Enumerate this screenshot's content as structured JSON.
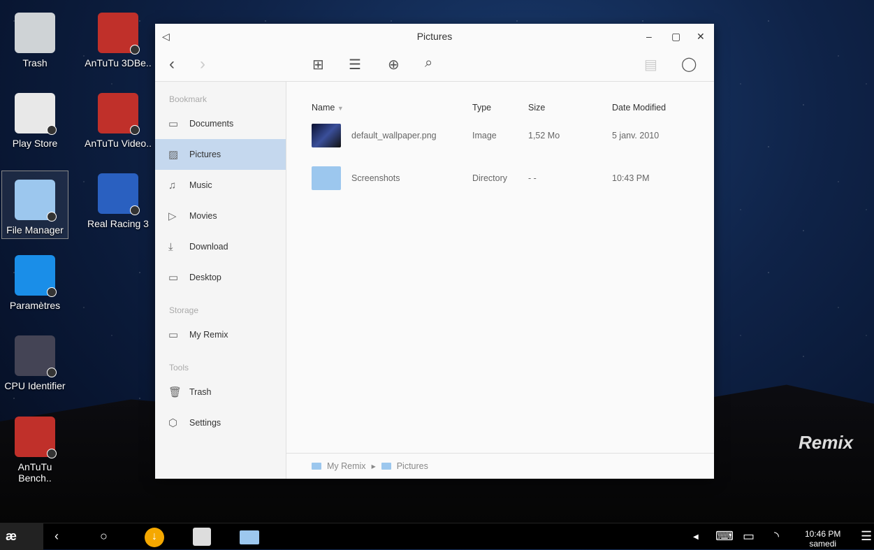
{
  "desktop": {
    "icons": [
      {
        "label": "Trash",
        "color": "#cfd3d6"
      },
      {
        "label": "AnTuTu 3DBe..",
        "color": "#c0302a"
      },
      {
        "label": "Play Store",
        "color": "#e8e8e8"
      },
      {
        "label": "AnTuTu Video..",
        "color": "#c0302a"
      },
      {
        "label": "File Manager",
        "color": "#9cc7ee"
      },
      {
        "label": "Real Racing 3",
        "color": "#2a60c0"
      },
      {
        "label": "Paramètres",
        "color": "#1a8ee8"
      },
      {
        "label": "CPU Identifier",
        "color": "#445"
      },
      {
        "label": "AnTuTu Bench..",
        "color": "#c0302a"
      }
    ],
    "brand": "Remix"
  },
  "window": {
    "title": "Pictures",
    "sidebar": {
      "bookmark_header": "Bookmark",
      "bookmarks": [
        "Documents",
        "Pictures",
        "Music",
        "Movies",
        "Download",
        "Desktop"
      ],
      "storage_header": "Storage",
      "storage": [
        "My Remix"
      ],
      "tools_header": "Tools",
      "tools": [
        "Trash",
        "Settings"
      ],
      "active": "Pictures"
    },
    "columns": [
      "Name",
      "Type",
      "Size",
      "Date Modified"
    ],
    "files": [
      {
        "name": "default_wallpaper.png",
        "type": "Image",
        "size": "1,52 Mo",
        "date": "5 janv. 2010"
      },
      {
        "name": "Screenshots",
        "type": "Directory",
        "size": "- -",
        "date": "10:43 PM"
      }
    ],
    "breadcrumb": [
      "My Remix",
      "Pictures"
    ]
  },
  "taskbar": {
    "time": "10:46 PM",
    "day": "samedi"
  }
}
